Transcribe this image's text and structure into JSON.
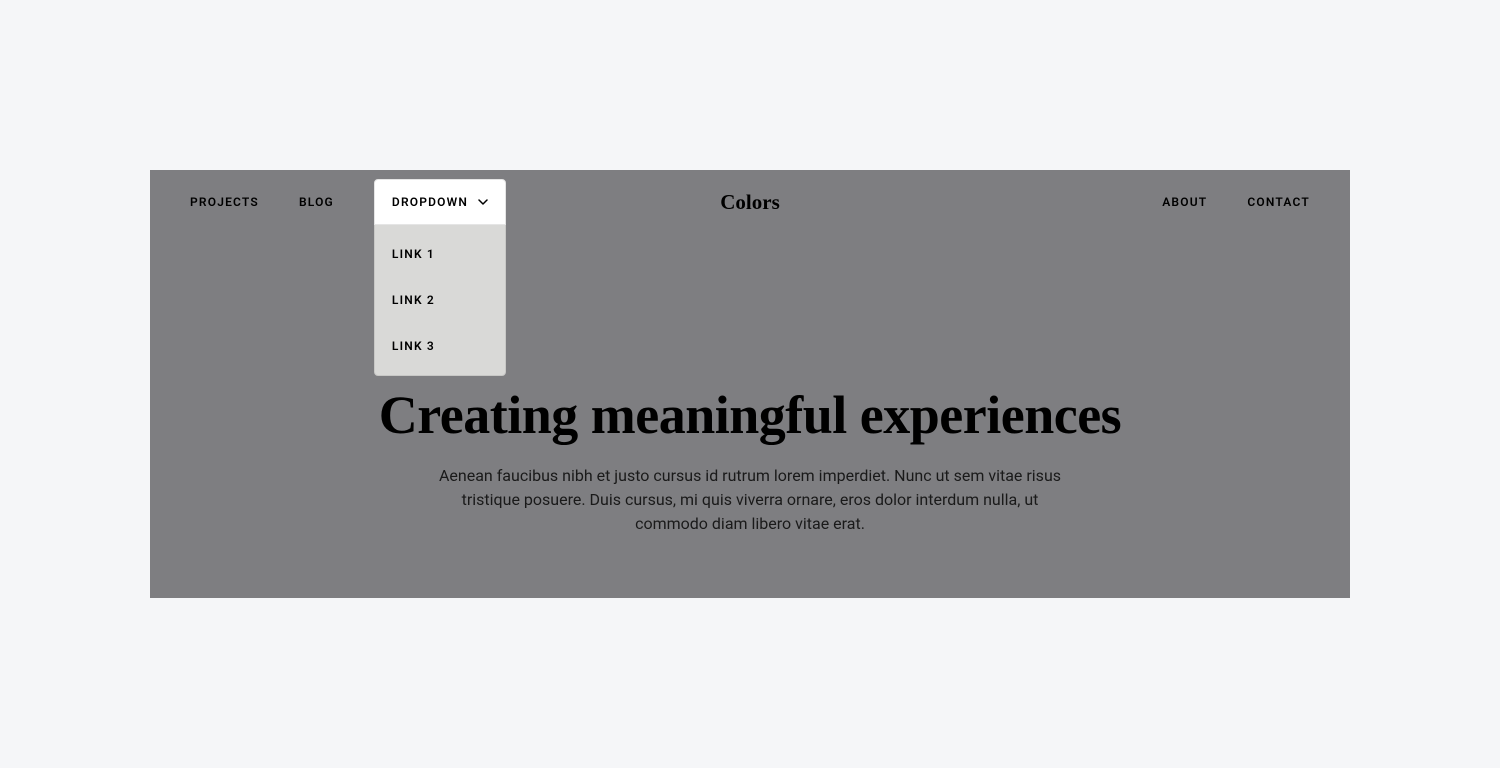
{
  "nav": {
    "left": [
      {
        "label": "PROJECTS"
      },
      {
        "label": "BLOG"
      }
    ],
    "dropdown": {
      "label": "DROPDOWN",
      "items": [
        {
          "label": "LINK 1"
        },
        {
          "label": "LINK 2"
        },
        {
          "label": "LINK 3"
        }
      ]
    },
    "right": [
      {
        "label": "ABOUT"
      },
      {
        "label": "CONTACT"
      }
    ],
    "logo": "Colors"
  },
  "hero": {
    "title": "Creating meaningful experiences",
    "subtitle": "Aenean faucibus nibh et justo cursus id rutrum lorem imperdiet. Nunc ut sem vitae risus tristique posuere. Duis cursus, mi quis viverra ornare, eros dolor interdum nulla, ut commodo diam libero vitae erat."
  }
}
